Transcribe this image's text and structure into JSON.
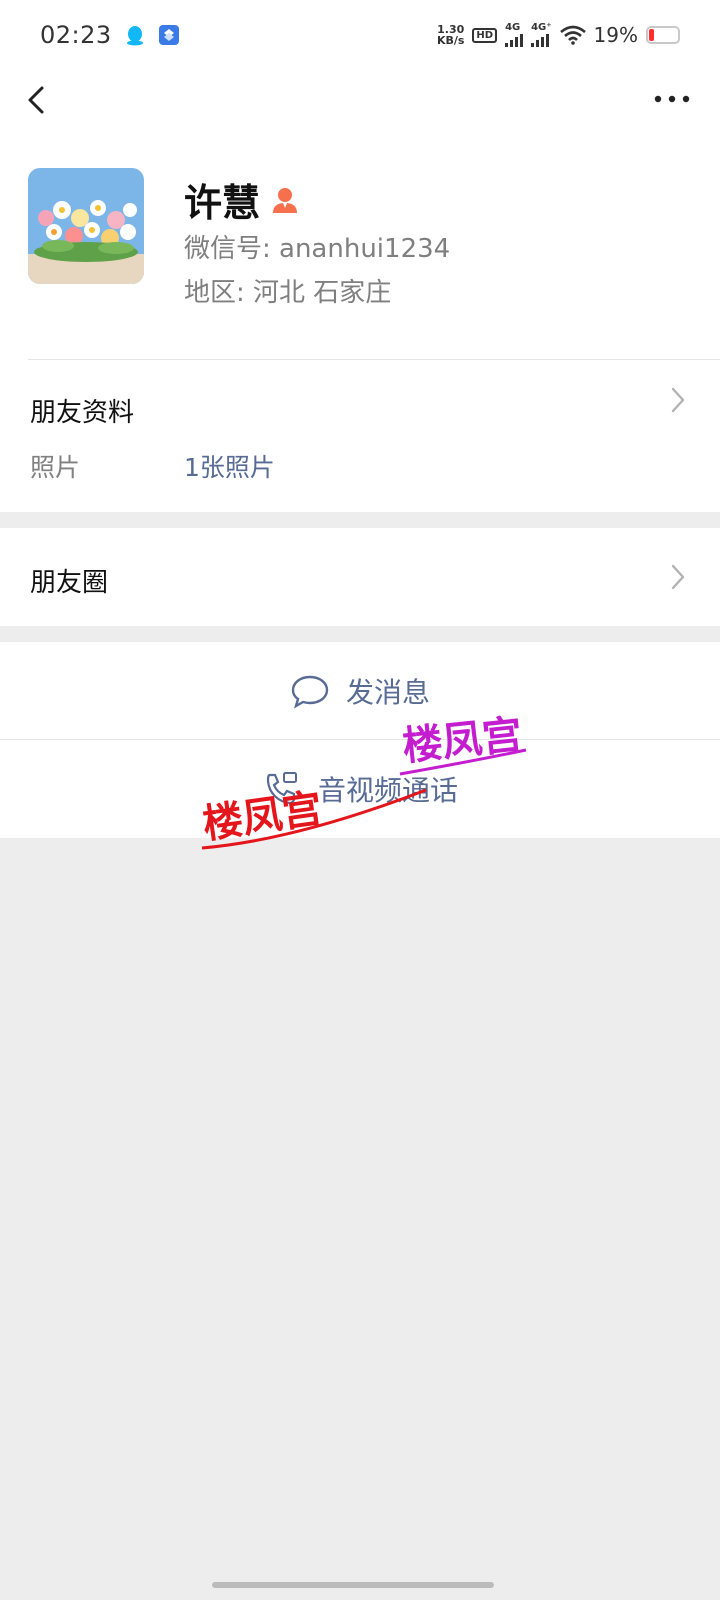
{
  "status_bar": {
    "time": "02:23",
    "net_speed_value": "1.30",
    "net_speed_unit": "KB/s",
    "hd_label": "HD",
    "network_1": "4G",
    "network_2": "4G⁺",
    "battery_percent": "19%",
    "battery_level": 0.19,
    "battery_color": "#ff2d2d"
  },
  "nav": {
    "back_icon": "chevron-left",
    "more_icon": "ellipsis"
  },
  "profile": {
    "name": "许慧",
    "gender_icon": "female-user",
    "gender_color": "#f7704e",
    "wechat_id": "微信号: ananhui1234",
    "region": "地区: 河北  石家庄"
  },
  "friend_info": {
    "title": "朋友资料",
    "photo_label": "照片",
    "photo_value": "1张照片"
  },
  "moments": {
    "title": "朋友圈"
  },
  "actions": {
    "send_message": "发消息",
    "av_call": "音视频通话"
  },
  "watermarks": [
    {
      "text": "楼凤宫",
      "color": "#e4161c"
    },
    {
      "text": "楼凤宫",
      "color": "#c41ccf"
    }
  ],
  "colors": {
    "link_blue": "#576b95",
    "background": "#ededed"
  }
}
